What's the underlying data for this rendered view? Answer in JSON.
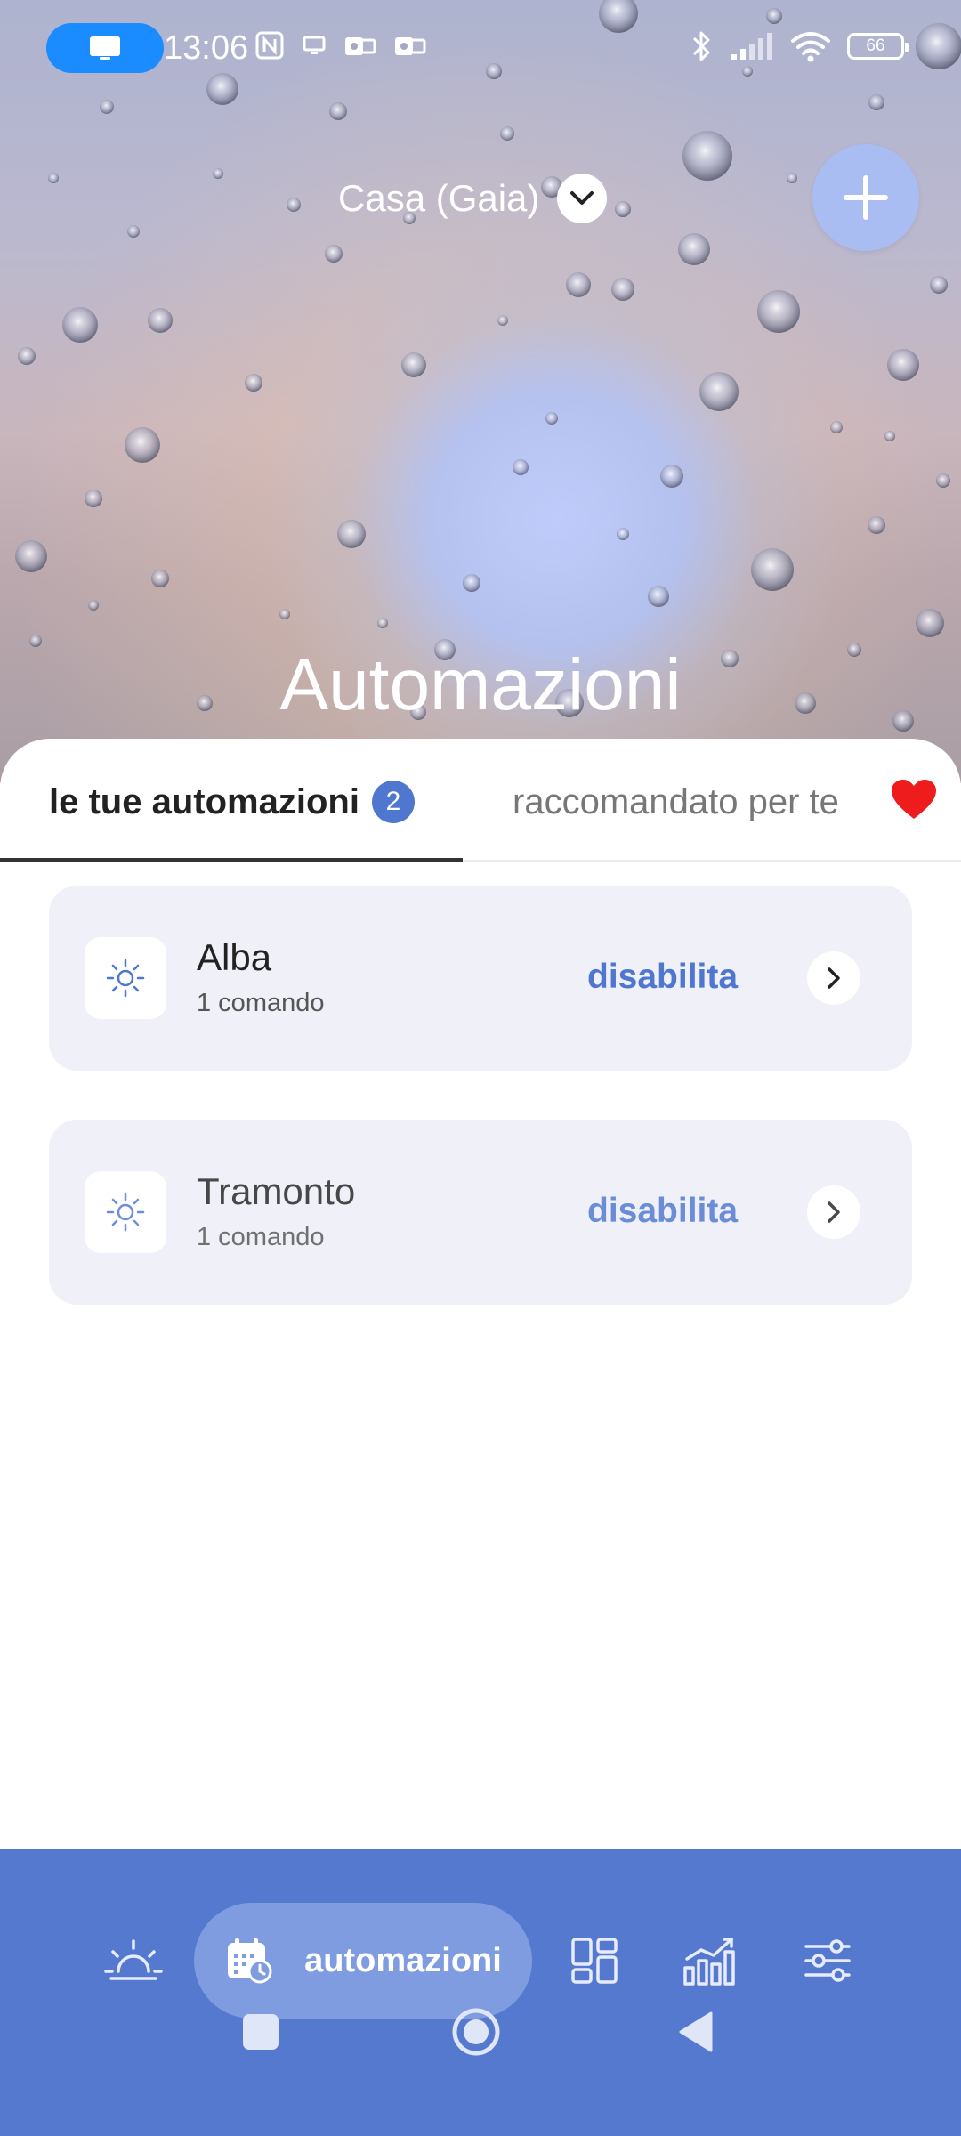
{
  "status_bar": {
    "time": "13:06",
    "battery": "66"
  },
  "header": {
    "home_name": "Casa (Gaia)",
    "page_title": "Automazioni"
  },
  "tabs": {
    "mine_label": "le tue automazioni",
    "mine_count": "2",
    "recommended_label": "raccomandato per te"
  },
  "automations": [
    {
      "name": "Alba",
      "commands": "1 comando",
      "action": "disabilita",
      "icon": "sun-icon"
    },
    {
      "name": "Tramonto",
      "commands": "1 comando",
      "action": "disabilita",
      "icon": "sun-icon"
    }
  ],
  "bottom_nav": {
    "active_label": "automazioni",
    "items": [
      "sunrise-icon",
      "calendar-clock-icon",
      "rooms-grid-icon",
      "bar-chart-icon",
      "sliders-icon"
    ]
  },
  "colors": {
    "accent": "#4f77cf",
    "nav_bar": "#5479cf",
    "nav_active_pill": "#7f9ce0",
    "add_button": "#a9bdf2",
    "cast_pill": "#1a8cff",
    "card_bg": "#eff0f8",
    "heart": "#ee1c1c"
  }
}
